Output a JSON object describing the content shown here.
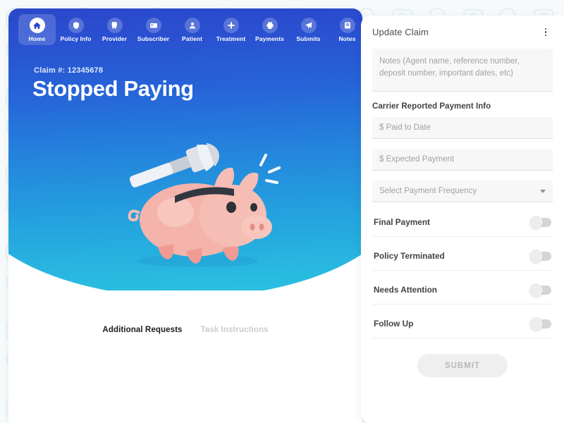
{
  "nav": {
    "items": [
      {
        "label": "Home",
        "icon": "home-icon",
        "active": true
      },
      {
        "label": "Policy Info",
        "icon": "shield-icon",
        "active": false
      },
      {
        "label": "Provider",
        "icon": "tooth-icon",
        "active": false
      },
      {
        "label": "Subscriber",
        "icon": "card-icon",
        "active": false
      },
      {
        "label": "Patient",
        "icon": "person-icon",
        "active": false
      },
      {
        "label": "Treatment",
        "icon": "plus-icon",
        "active": false
      },
      {
        "label": "Payments",
        "icon": "printer-icon",
        "active": false
      },
      {
        "label": "Submits",
        "icon": "paper-plane-icon",
        "active": false
      },
      {
        "label": "Notes",
        "icon": "document-icon",
        "active": false
      }
    ]
  },
  "hero": {
    "claim_number": "Claim #: 12345678",
    "title": "Stopped Paying",
    "illustration": "piggy-bank-with-hammer"
  },
  "tabs": [
    {
      "label": "Additional Requests",
      "active": true
    },
    {
      "label": "Task Instructions",
      "active": false
    }
  ],
  "panel": {
    "title": "Update Claim",
    "menu_icon": "kebab-menu-icon",
    "notes": {
      "value": "",
      "placeholder": "Notes (Agent name, reference number, deposit number, important dates, etc)"
    },
    "section_label": "Carrier Reported Payment Info",
    "fields": [
      {
        "name": "paid-to-date",
        "value": "",
        "placeholder": "$  Paid to Date"
      },
      {
        "name": "expected-payment",
        "value": "",
        "placeholder": "$  Expected Payment"
      }
    ],
    "select": {
      "name": "payment-frequency",
      "value": "Select Payment Frequency",
      "caret_icon": "chevron-down-icon"
    },
    "toggles": [
      {
        "label": "Final Payment",
        "on": false
      },
      {
        "label": "Policy Terminated",
        "on": false
      },
      {
        "label": "Needs Attention",
        "on": false
      },
      {
        "label": "Follow Up",
        "on": false
      }
    ],
    "submit": {
      "label": "SUBMIT",
      "disabled": true
    }
  },
  "colors": {
    "hero_top": "#2b45c8",
    "hero_bottom": "#2cc2e0",
    "panel_bg": "#ffffff",
    "page_bg": "#f7fafb",
    "piggy_pink": "#f4b3ab",
    "submit_disabled": "#efefef"
  }
}
